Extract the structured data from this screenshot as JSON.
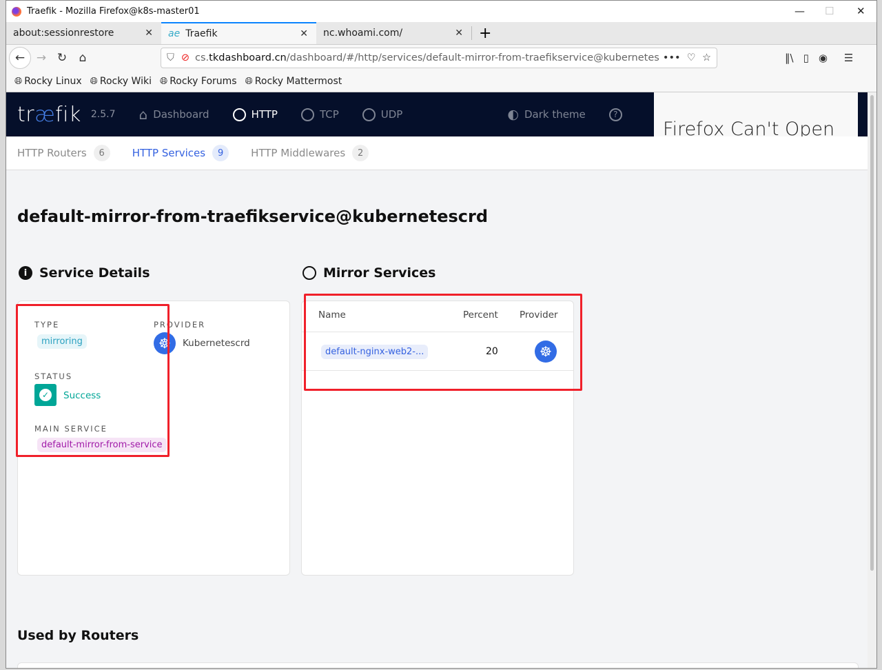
{
  "window": {
    "title": "Traefik - Mozilla Firefox@k8s-master01"
  },
  "tabs": [
    {
      "label": "about:sessionrestore"
    },
    {
      "label": "Traefik",
      "icon": "ae"
    },
    {
      "label": "nc.whoami.com/"
    }
  ],
  "url": {
    "host_prefix": "cs.",
    "host": "tkdashboard.cn",
    "path": "/dashboard/#/http/services/default-mirror-from-traefikservice@kubernetescr"
  },
  "bookmarks": [
    "Rocky Linux",
    "Rocky Wiki",
    "Rocky Forums",
    "Rocky Mattermost"
  ],
  "header": {
    "logo_a": "tr",
    "logo_b": "æ",
    "logo_c": "fik",
    "version": "2.5.7",
    "nav": [
      "Dashboard",
      "HTTP",
      "TCP",
      "UDP"
    ],
    "theme": "Dark theme",
    "overlay": "Firefox Can't Open"
  },
  "subnav": [
    {
      "label": "HTTP Routers",
      "count": "6"
    },
    {
      "label": "HTTP Services",
      "count": "9"
    },
    {
      "label": "HTTP Middlewares",
      "count": "2"
    }
  ],
  "page_title": "default-mirror-from-traefikservice@kubernetescrd",
  "details": {
    "heading": "Service Details",
    "type_label": "TYPE",
    "type": "mirroring",
    "provider_label": "PROVIDER",
    "provider": "Kubernetescrd",
    "status_label": "STATUS",
    "status": "Success",
    "main_label": "MAIN SERVICE",
    "main": "default-mirror-from-service"
  },
  "mirrors": {
    "heading": "Mirror Services",
    "columns": [
      "Name",
      "Percent",
      "Provider"
    ],
    "rows": [
      {
        "name": "default-nginx-web2-...",
        "percent": "20",
        "provider": "kubernetes"
      }
    ]
  },
  "routers": {
    "heading": "Used by Routers"
  },
  "colors": {
    "accent": "#3562e0",
    "header_bg": "#050f2a",
    "success": "#00a697",
    "highlight": "#f0202a"
  }
}
